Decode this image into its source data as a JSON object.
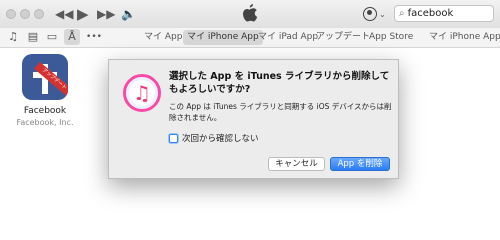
{
  "search": {
    "value": "facebook"
  },
  "nav": {
    "tabs": [
      "マイ App",
      "マイ iPhone App",
      "マイ iPad App",
      "アップデート",
      "App Store"
    ],
    "device_menu": "マイ iPhone App",
    "more_glyph": "•••"
  },
  "app": {
    "name": "Facebook",
    "developer": "Facebook, Inc.",
    "badge": "アップデート"
  },
  "dialog": {
    "title": "選択した App を iTunes ライブラリから削除してもよろしいですか?",
    "message": "この App は iTunes ライブラリと同期する iOS デバイスからは削除されません。",
    "checkbox_label": "次回から確認しない",
    "cancel_label": "キャンセル",
    "delete_label": "App を削除"
  },
  "colors": {
    "accent": "#2b7cf6",
    "facebook_blue": "#3d5a98",
    "badge_red": "#d4322f"
  }
}
